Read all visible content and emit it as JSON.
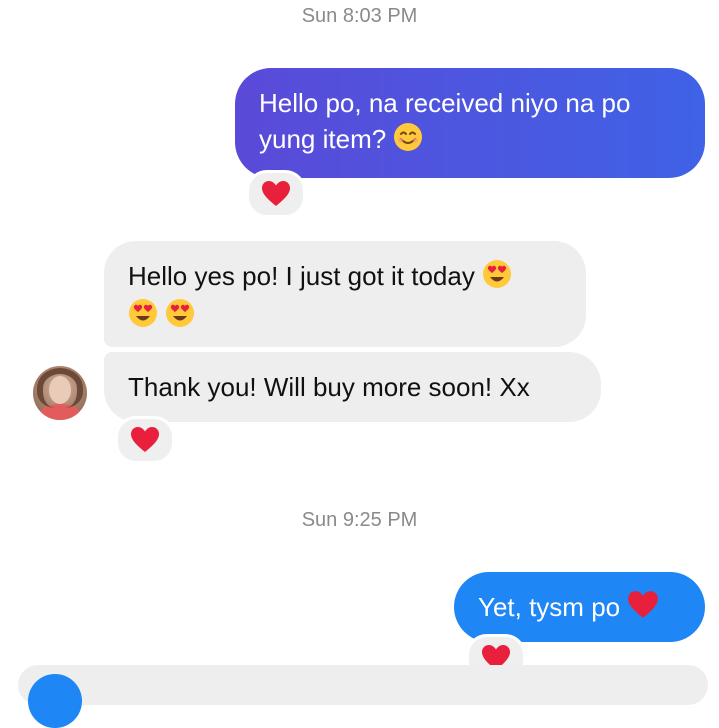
{
  "timestamps": [
    "Sun 8:03 PM",
    "Sun 9:25 PM"
  ],
  "messages": [
    {
      "direction": "outgoing",
      "text": "Hello po, na received niyo na po yung item?",
      "emoji": "smiling-face-icon",
      "reaction": "red-heart-icon"
    },
    {
      "direction": "incoming",
      "text": "Hello yes po! I just got it today",
      "emoji": "heart-eyes-face-icon x3"
    },
    {
      "direction": "incoming",
      "text": "Thank you! Will buy more soon! Xx",
      "reaction": "red-heart-icon"
    },
    {
      "direction": "outgoing",
      "text": "Yet, tysm po",
      "emoji": "red-heart-icon",
      "reaction": "red-heart-icon"
    }
  ],
  "colors": {
    "outgoing_gradient_start": "#5a4ad8",
    "outgoing_gradient_end": "#3f62e6",
    "outgoing_blue": "#1e86f5",
    "incoming_bg": "#eeeeee",
    "timestamp": "#8a8a8a",
    "heart": "#e8203c"
  }
}
